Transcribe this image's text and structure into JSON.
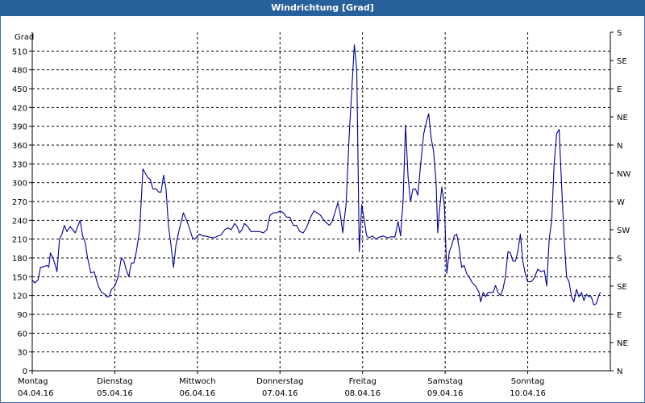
{
  "window": {
    "title": "Windrichtung [Grad]"
  },
  "chart_data": {
    "type": "line",
    "title": "Windrichtung [Grad]",
    "ylabel": "Grad",
    "ylim": [
      0,
      540
    ],
    "y_ticks": [
      0,
      30,
      60,
      90,
      120,
      150,
      180,
      210,
      240,
      270,
      300,
      330,
      360,
      390,
      420,
      450,
      480,
      510
    ],
    "right_axis": {
      "labels": [
        "N",
        "NE",
        "E",
        "SE",
        "S",
        "SW",
        "W",
        "NW",
        "N",
        "NE",
        "E",
        "SE",
        "S"
      ],
      "values": [
        0,
        45,
        90,
        135,
        180,
        225,
        270,
        315,
        360,
        405,
        450,
        495,
        540
      ]
    },
    "xlim": [
      0,
      7
    ],
    "x_ticks": [
      {
        "day": "Montag",
        "date": "04.04.16",
        "x": 0
      },
      {
        "day": "Dienstag",
        "date": "05.04.16",
        "x": 1
      },
      {
        "day": "Mittwoch",
        "date": "06.04.16",
        "x": 2
      },
      {
        "day": "Donnerstag",
        "date": "07.04.16",
        "x": 3
      },
      {
        "day": "Freitag",
        "date": "08.04.16",
        "x": 4
      },
      {
        "day": "Samstag",
        "date": "09.04.16",
        "x": 5
      },
      {
        "day": "Sonntag",
        "date": "10.04.16",
        "x": 6
      }
    ],
    "grid": true,
    "colors": {
      "line": "#00008b",
      "grid": "#000000",
      "title_bar": "#27609a"
    },
    "series": [
      {
        "points": [
          [
            0.0,
            145
          ],
          [
            0.03,
            140
          ],
          [
            0.07,
            145
          ],
          [
            0.1,
            165
          ],
          [
            0.14,
            166
          ],
          [
            0.18,
            168
          ],
          [
            0.2,
            165
          ],
          [
            0.22,
            188
          ],
          [
            0.25,
            180
          ],
          [
            0.28,
            168
          ],
          [
            0.3,
            158
          ],
          [
            0.33,
            210
          ],
          [
            0.36,
            218
          ],
          [
            0.39,
            232
          ],
          [
            0.42,
            222
          ],
          [
            0.46,
            230
          ],
          [
            0.49,
            225
          ],
          [
            0.52,
            220
          ],
          [
            0.55,
            230
          ],
          [
            0.58,
            240
          ],
          [
            0.61,
            215
          ],
          [
            0.64,
            205
          ],
          [
            0.67,
            180
          ],
          [
            0.71,
            156
          ],
          [
            0.75,
            158
          ],
          [
            0.8,
            135
          ],
          [
            0.84,
            125
          ],
          [
            0.88,
            122
          ],
          [
            0.9,
            118
          ],
          [
            0.93,
            118
          ],
          [
            0.96,
            130
          ],
          [
            1.0,
            135
          ],
          [
            1.04,
            150
          ],
          [
            1.08,
            180
          ],
          [
            1.11,
            175
          ],
          [
            1.14,
            160
          ],
          [
            1.17,
            150
          ],
          [
            1.2,
            172
          ],
          [
            1.23,
            172
          ],
          [
            1.26,
            190
          ],
          [
            1.3,
            225
          ],
          [
            1.34,
            322
          ],
          [
            1.37,
            315
          ],
          [
            1.4,
            308
          ],
          [
            1.43,
            305
          ],
          [
            1.46,
            290
          ],
          [
            1.5,
            290
          ],
          [
            1.53,
            285
          ],
          [
            1.56,
            285
          ],
          [
            1.59,
            312
          ],
          [
            1.62,
            290
          ],
          [
            1.65,
            230
          ],
          [
            1.68,
            200
          ],
          [
            1.71,
            165
          ],
          [
            1.74,
            200
          ],
          [
            1.78,
            225
          ],
          [
            1.83,
            252
          ],
          [
            1.87,
            240
          ],
          [
            1.91,
            225
          ],
          [
            1.94,
            212
          ],
          [
            1.97,
            210
          ],
          [
            2.0,
            215
          ],
          [
            2.03,
            218
          ],
          [
            2.06,
            215
          ],
          [
            2.1,
            215
          ],
          [
            2.15,
            213
          ],
          [
            2.2,
            212
          ],
          [
            2.25,
            215
          ],
          [
            2.29,
            217
          ],
          [
            2.33,
            225
          ],
          [
            2.37,
            228
          ],
          [
            2.41,
            225
          ],
          [
            2.45,
            235
          ],
          [
            2.48,
            230
          ],
          [
            2.51,
            220
          ],
          [
            2.54,
            225
          ],
          [
            2.57,
            235
          ],
          [
            2.61,
            230
          ],
          [
            2.65,
            222
          ],
          [
            2.7,
            222
          ],
          [
            2.75,
            222
          ],
          [
            2.8,
            220
          ],
          [
            2.84,
            225
          ],
          [
            2.88,
            248
          ],
          [
            2.92,
            252
          ],
          [
            2.96,
            252
          ],
          [
            3.0,
            255
          ],
          [
            3.04,
            252
          ],
          [
            3.08,
            245
          ],
          [
            3.12,
            245
          ],
          [
            3.16,
            232
          ],
          [
            3.2,
            232
          ],
          [
            3.24,
            222
          ],
          [
            3.28,
            220
          ],
          [
            3.32,
            228
          ],
          [
            3.37,
            245
          ],
          [
            3.41,
            255
          ],
          [
            3.45,
            252
          ],
          [
            3.49,
            248
          ],
          [
            3.53,
            240
          ],
          [
            3.57,
            235
          ],
          [
            3.6,
            232
          ],
          [
            3.63,
            238
          ],
          [
            3.66,
            250
          ],
          [
            3.7,
            268
          ],
          [
            3.73,
            250
          ],
          [
            3.76,
            220
          ],
          [
            3.8,
            265
          ],
          [
            3.84,
            380
          ],
          [
            3.87,
            450
          ],
          [
            3.9,
            520
          ],
          [
            3.93,
            480
          ],
          [
            3.96,
            190
          ],
          [
            3.99,
            265
          ],
          [
            4.02,
            240
          ],
          [
            4.05,
            215
          ],
          [
            4.08,
            212
          ],
          [
            4.12,
            215
          ],
          [
            4.16,
            210
          ],
          [
            4.2,
            213
          ],
          [
            4.25,
            215
          ],
          [
            4.3,
            212
          ],
          [
            4.35,
            214
          ],
          [
            4.39,
            213
          ],
          [
            4.43,
            238
          ],
          [
            4.46,
            215
          ],
          [
            4.49,
            270
          ],
          [
            4.52,
            392
          ],
          [
            4.55,
            310
          ],
          [
            4.58,
            270
          ],
          [
            4.61,
            290
          ],
          [
            4.64,
            290
          ],
          [
            4.67,
            280
          ],
          [
            4.7,
            325
          ],
          [
            4.74,
            378
          ],
          [
            4.77,
            395
          ],
          [
            4.8,
            410
          ],
          [
            4.83,
            372
          ],
          [
            4.86,
            350
          ],
          [
            4.89,
            300
          ],
          [
            4.91,
            220
          ],
          [
            4.93,
            255
          ],
          [
            4.96,
            293
          ],
          [
            4.99,
            265
          ],
          [
            5.02,
            155
          ],
          [
            5.05,
            190
          ],
          [
            5.08,
            200
          ],
          [
            5.11,
            215
          ],
          [
            5.14,
            218
          ],
          [
            5.17,
            195
          ],
          [
            5.2,
            165
          ],
          [
            5.23,
            168
          ],
          [
            5.26,
            155
          ],
          [
            5.29,
            150
          ],
          [
            5.33,
            140
          ],
          [
            5.37,
            135
          ],
          [
            5.41,
            125
          ],
          [
            5.43,
            110
          ],
          [
            5.46,
            125
          ],
          [
            5.49,
            118
          ],
          [
            5.52,
            125
          ],
          [
            5.55,
            125
          ],
          [
            5.58,
            125
          ],
          [
            5.61,
            136
          ],
          [
            5.64,
            125
          ],
          [
            5.67,
            120
          ],
          [
            5.7,
            130
          ],
          [
            5.73,
            150
          ],
          [
            5.76,
            190
          ],
          [
            5.79,
            188
          ],
          [
            5.82,
            175
          ],
          [
            5.85,
            175
          ],
          [
            5.88,
            190
          ],
          [
            5.91,
            218
          ],
          [
            5.94,
            175
          ],
          [
            5.97,
            155
          ],
          [
            6.0,
            142
          ],
          [
            6.04,
            142
          ],
          [
            6.08,
            148
          ],
          [
            6.12,
            162
          ],
          [
            6.16,
            158
          ],
          [
            6.2,
            160
          ],
          [
            6.23,
            135
          ],
          [
            6.26,
            210
          ],
          [
            6.29,
            240
          ],
          [
            6.32,
            330
          ],
          [
            6.35,
            378
          ],
          [
            6.38,
            385
          ],
          [
            6.41,
            295
          ],
          [
            6.44,
            215
          ],
          [
            6.47,
            150
          ],
          [
            6.5,
            142
          ],
          [
            6.53,
            118
          ],
          [
            6.56,
            110
          ],
          [
            6.59,
            130
          ],
          [
            6.62,
            118
          ],
          [
            6.65,
            125
          ],
          [
            6.68,
            112
          ],
          [
            6.71,
            122
          ],
          [
            6.74,
            118
          ],
          [
            6.77,
            118
          ],
          [
            6.8,
            105
          ],
          [
            6.83,
            107
          ],
          [
            6.86,
            120
          ],
          [
            6.88,
            125
          ]
        ]
      }
    ]
  }
}
